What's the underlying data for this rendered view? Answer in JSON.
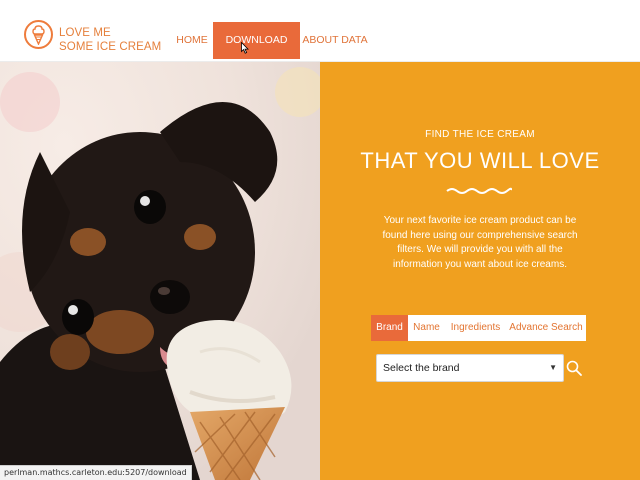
{
  "brand": {
    "line1": "LOVE ME",
    "line2": "SOME ICE CREAM",
    "logo_icon": "ice-cream-icon",
    "color": "#e5803c"
  },
  "nav": {
    "items": [
      "HOME",
      "DOWNLOAD DATA",
      "ABOUT DATA"
    ],
    "active": "DOWNLOAD DATA",
    "active_color": "#e96a3a"
  },
  "hero": {
    "kicker": "FIND THE ICE CREAM",
    "headline": "THAT YOU WILL LOVE",
    "description": "Your next favorite ice cream product can be found here using our comprehensive search filters. We will provide you with all the information you want about ice creams.",
    "background_color": "#f0a01f"
  },
  "tabs": {
    "items": [
      "Brand",
      "Name",
      "Ingredients",
      "Advance Search"
    ],
    "active": "Brand"
  },
  "search": {
    "select_value": "Select the brand",
    "button_icon": "search-icon"
  },
  "image": {
    "subject": "puppy-licking-ice-cream-cone"
  },
  "status_bar": {
    "url": "perlman.mathcs.carleton.edu:5207/download"
  }
}
